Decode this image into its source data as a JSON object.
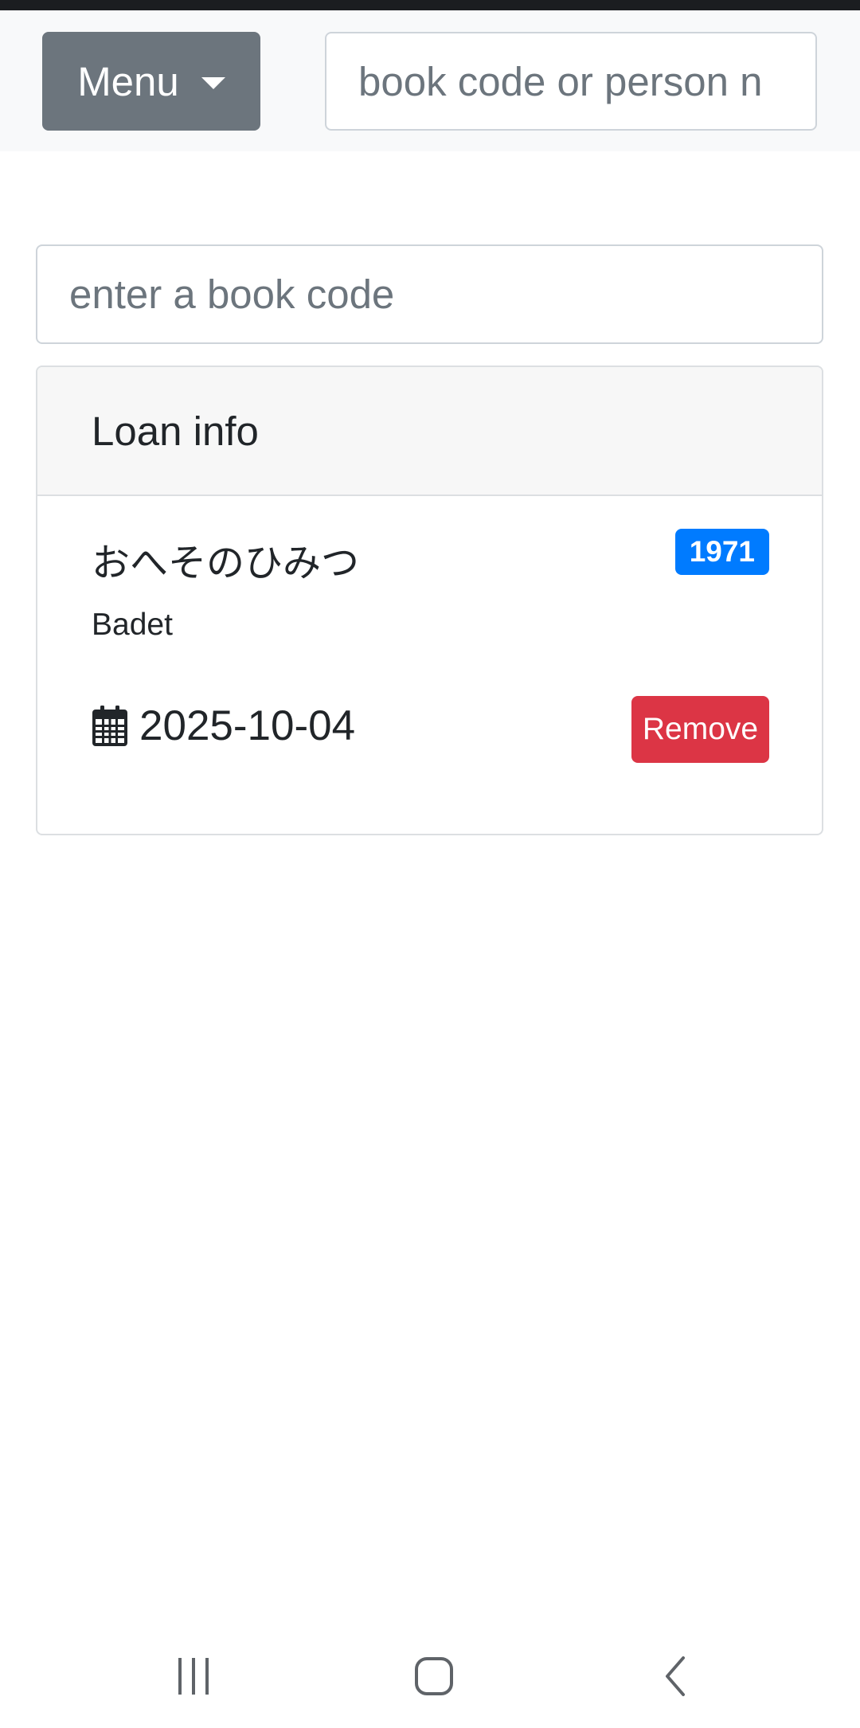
{
  "navbar": {
    "menu_label": "Menu",
    "search_placeholder": "book code or person n"
  },
  "main": {
    "code_input_placeholder": "enter a book code"
  },
  "loan_card": {
    "header": "Loan info",
    "book_title": "おへそのひみつ",
    "book_code": "1971",
    "author": "Badet",
    "due_date": "2025-10-04",
    "remove_label": "Remove"
  },
  "icons": {
    "caret": "chevron-down-icon",
    "calendar": "calendar-icon",
    "recents": "recents-icon",
    "home": "home-icon",
    "back": "back-icon"
  },
  "colors": {
    "menu_button": "#6c757d",
    "badge": "#007bff",
    "remove_button": "#dc3545",
    "navbar_bg": "#f8f9fa",
    "card_header_bg": "#f7f7f7"
  }
}
